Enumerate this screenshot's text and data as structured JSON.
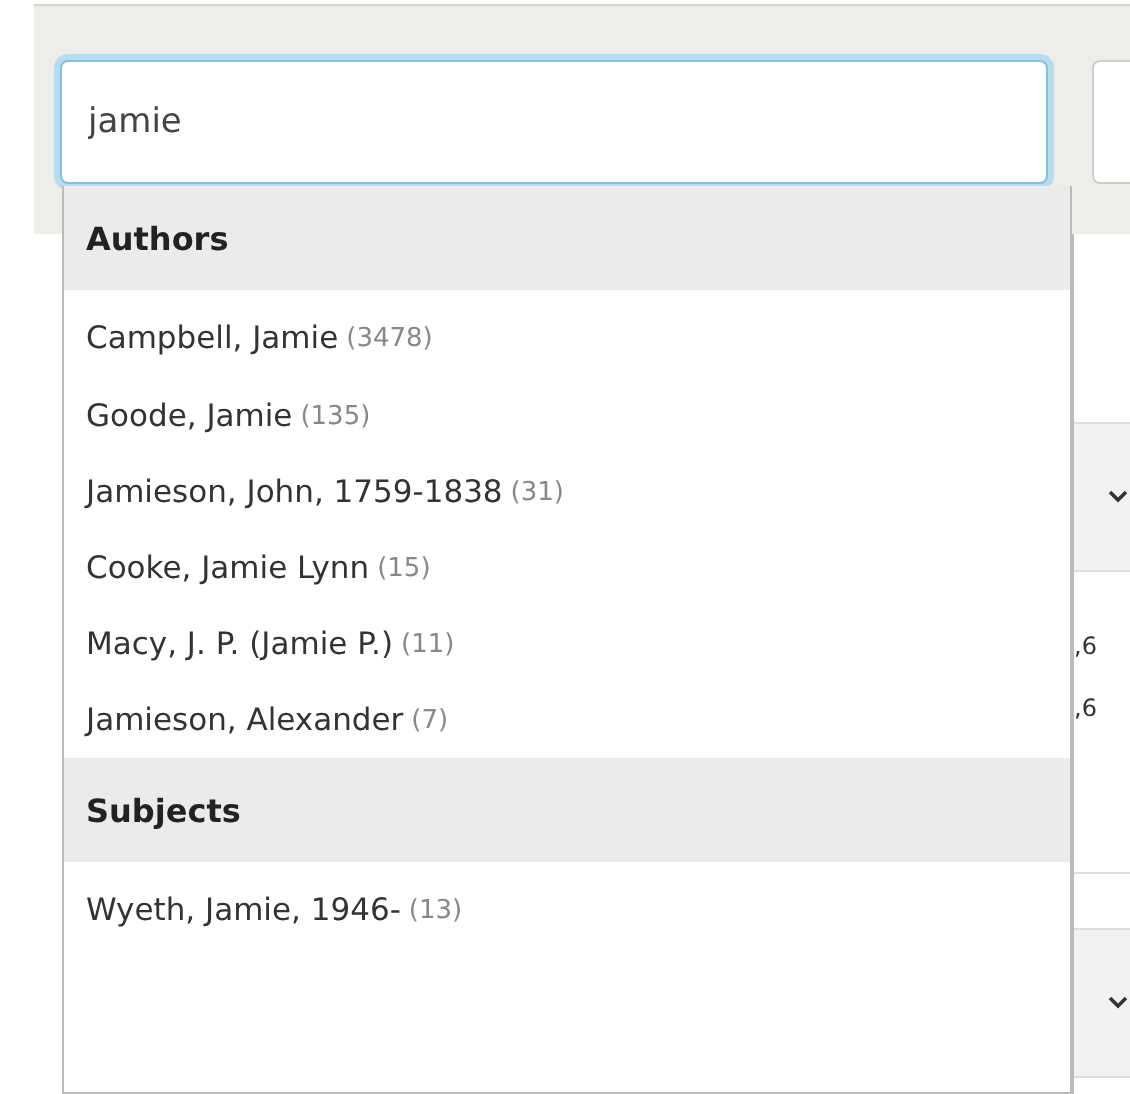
{
  "search": {
    "value": "jamie"
  },
  "suggestions": [
    {
      "heading": "Authors",
      "items": [
        {
          "label": "Campbell, Jamie",
          "count": "(3478)"
        },
        {
          "label": "Goode, Jamie",
          "count": "(135)"
        },
        {
          "label": "Jamieson, John, 1759-1838",
          "count": "(31)"
        },
        {
          "label": "Cooke, Jamie Lynn",
          "count": "(15)"
        },
        {
          "label": "Macy, J. P. (Jamie P.)",
          "count": "(11)"
        },
        {
          "label": "Jamieson, Alexander",
          "count": "(7)"
        }
      ]
    },
    {
      "heading": "Subjects",
      "items": [
        {
          "label": "Wyeth, Jamie, 1946-",
          "count": "(13)"
        }
      ]
    }
  ],
  "background_snippets": [
    ",6",
    ",6"
  ]
}
